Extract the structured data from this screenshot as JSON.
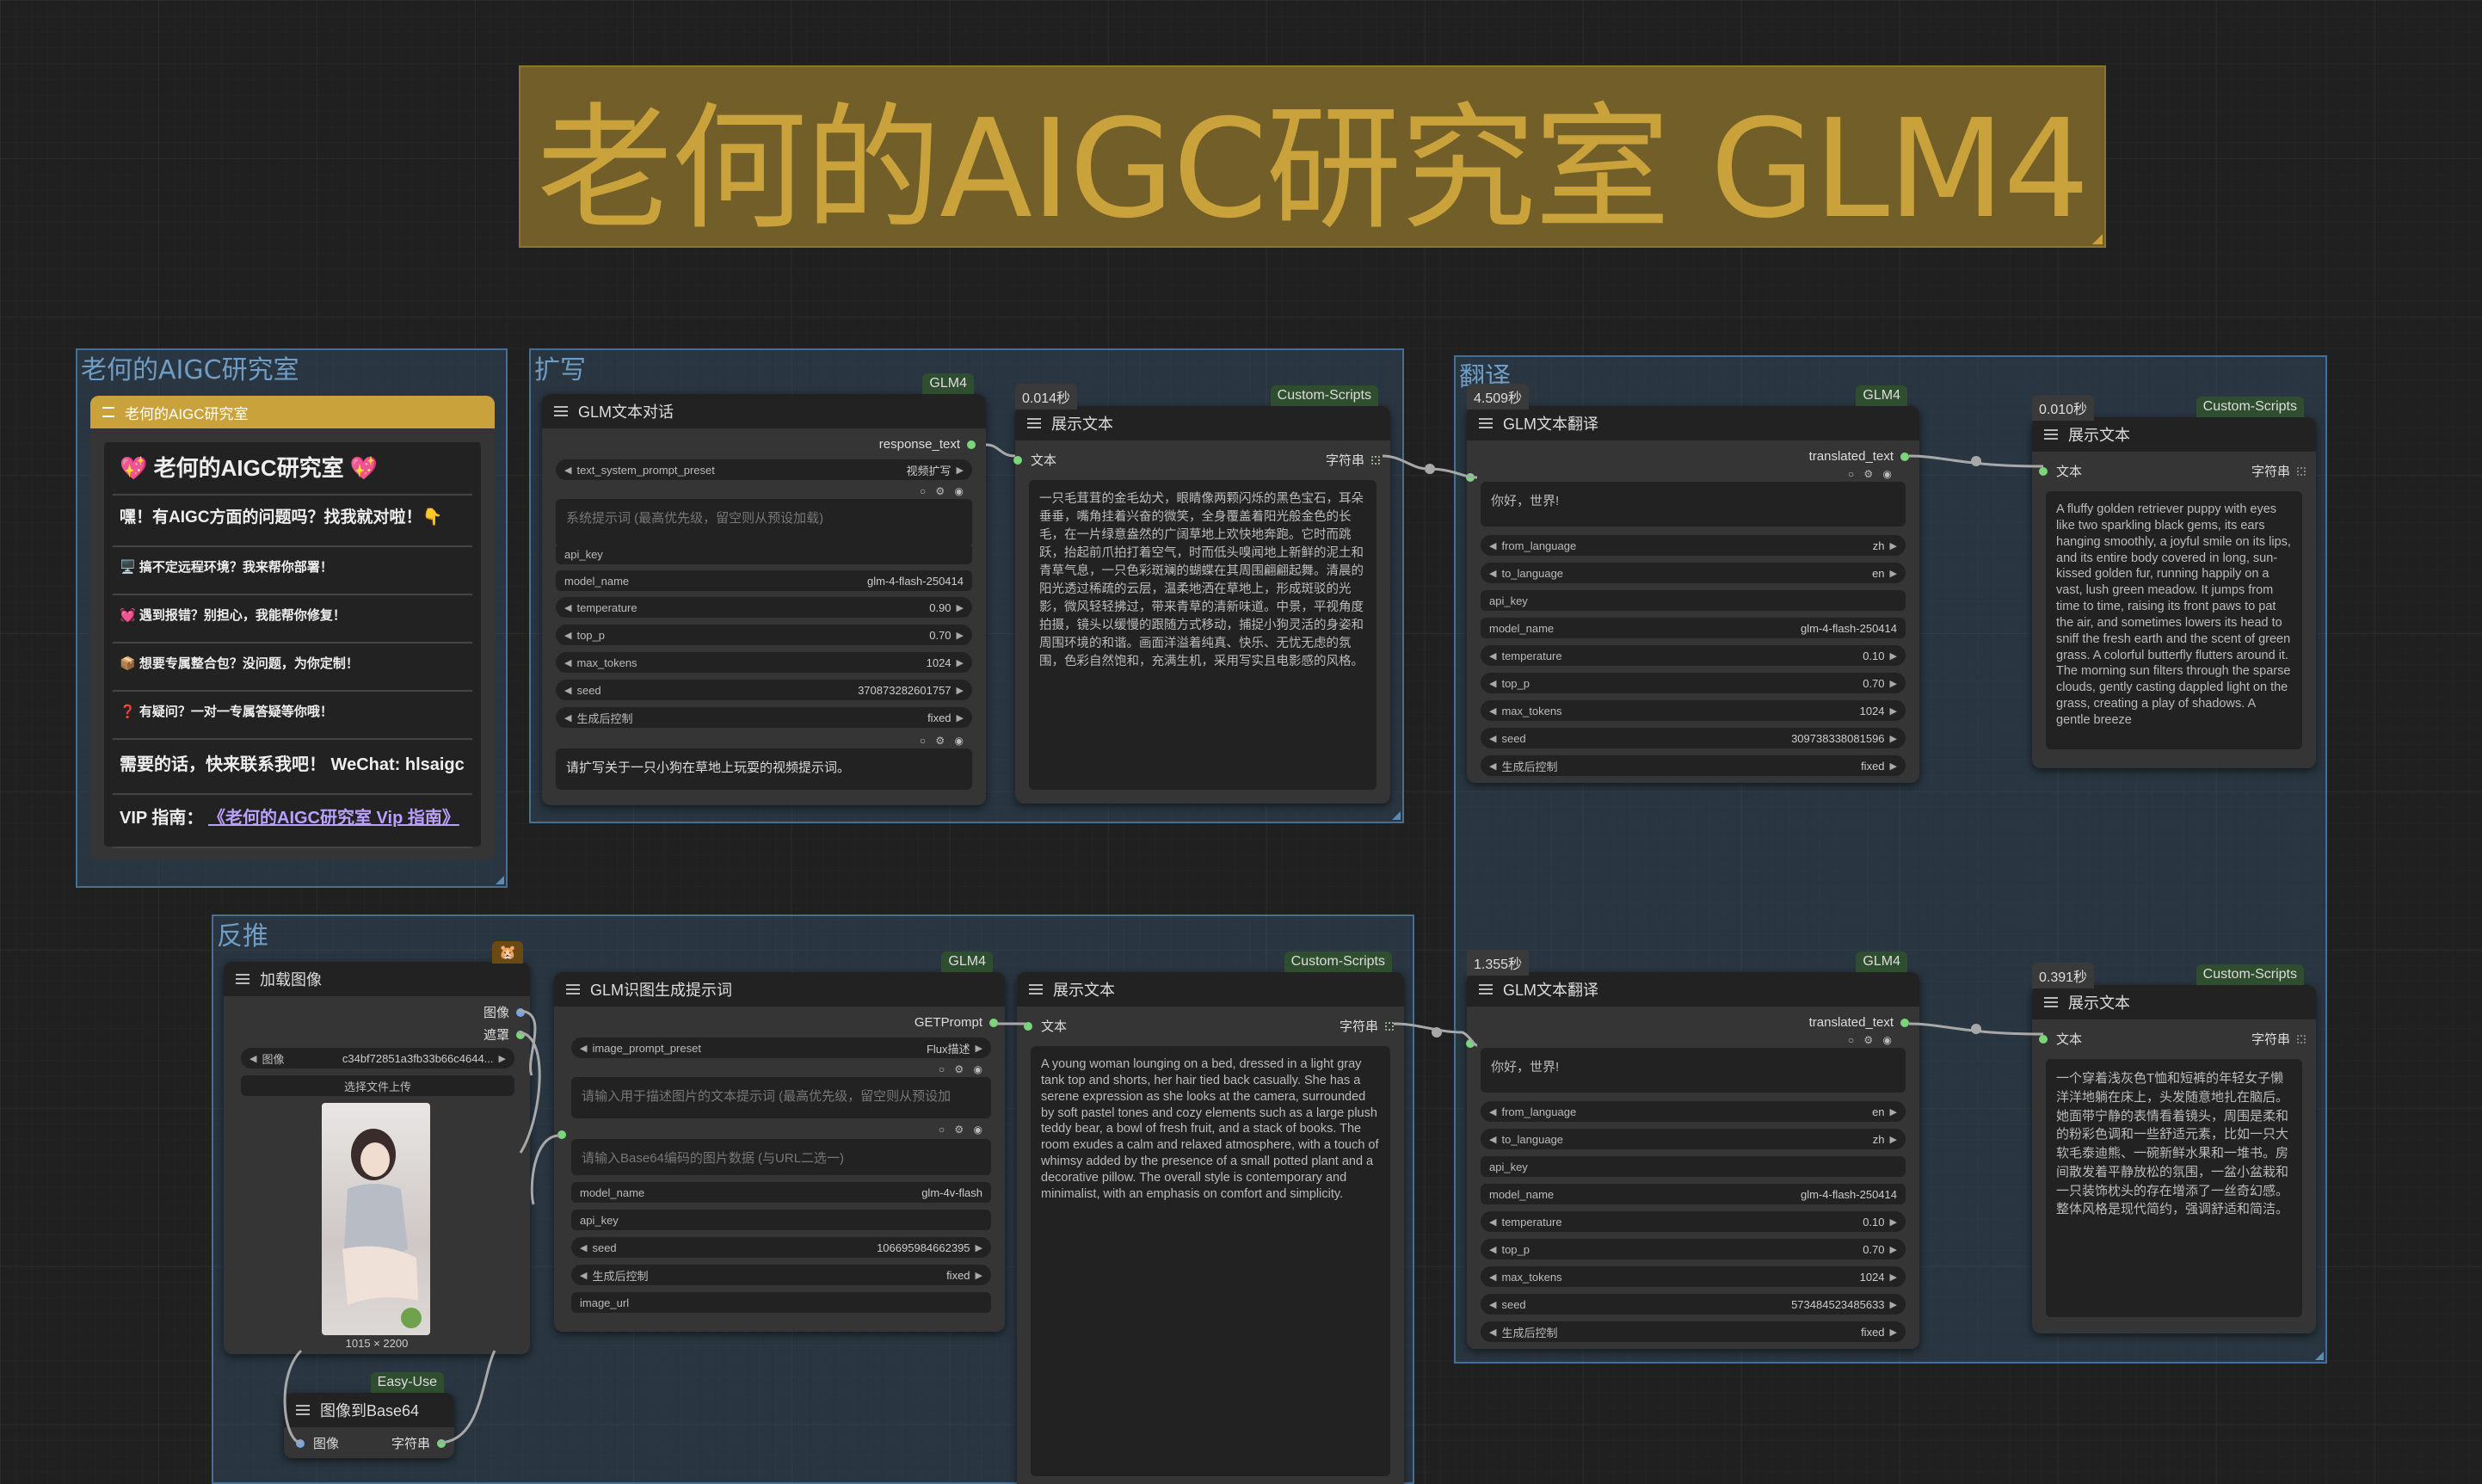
{
  "banner": {
    "title": "老何的AIGC研究室 GLM4"
  },
  "groups": {
    "lab": "老何的AIGC研究室",
    "expand": "扩写",
    "translate": "翻译",
    "reverse": "反推"
  },
  "promo": {
    "header": "老何的AIGC研究室",
    "title": "💖 老何的AIGC研究室 💖",
    "line1": "嘿！有AIGC方面的问题吗？找我就对啦！👇",
    "line2": "🖥️ 搞不定远程环境？我来帮你部署！",
    "line3": "💓 遇到报错？别担心，我能帮你修复！",
    "line4": "📦 想要专属整合包？没问题，为你定制！",
    "line5": "❓ 有疑问？一对一专属答疑等你哦！",
    "line6": "需要的话，快来联系我吧！ WeChat: hlsaigc",
    "vip_label": "VIP 指南：",
    "vip_link": "《老何的AIGC研究室 Vip 指南》"
  },
  "chat_node": {
    "badge": "GLM4",
    "title": "GLM文本对话",
    "output": "response_text",
    "preset_label": "text_system_prompt_preset",
    "preset_value": "视频扩写",
    "system_placeholder": "系统提示词 (最高优先级，留空则从预设加载)",
    "api_key": "api_key",
    "model_name_label": "model_name",
    "model_name": "glm-4-flash-250414",
    "temperature_label": "temperature",
    "temperature": "0.90",
    "top_p_label": "top_p",
    "top_p": "0.70",
    "max_tokens_label": "max_tokens",
    "max_tokens": "1024",
    "seed_label": "seed",
    "seed": "370873282601757",
    "control_label": "生成后控制",
    "control": "fixed",
    "user_prompt": "请扩写关于一只小狗在草地上玩耍的视频提示词。"
  },
  "show_text_1": {
    "time": "0.014秒",
    "badge": "Custom-Scripts",
    "title": "展示文本",
    "input": "文本",
    "output": "字符串",
    "text": "一只毛茸茸的金毛幼犬，眼睛像两颗闪烁的黑色宝石，耳朵垂垂，嘴角挂着兴奋的微笑，全身覆盖着阳光般金色的长毛，在一片绿意盎然的广阔草地上欢快地奔跑。它时而跳跃，抬起前爪拍打着空气，时而低头嗅闻地上新鲜的泥土和青草气息，一只色彩斑斓的蝴蝶在其周围翩翩起舞。清晨的阳光透过稀疏的云层，温柔地洒在草地上，形成斑驳的光影，微风轻轻拂过，带来青草的清新味道。中景，平视角度拍摄，镜头以缓慢的跟随方式移动，捕捉小狗灵活的身姿和周围环境的和谐。画面洋溢着纯真、快乐、无忧无虑的氛围，色彩自然饱和，充满生机，采用写实且电影感的风格。"
  },
  "translate_1": {
    "time": "4.509秒",
    "badge": "GLM4",
    "title": "GLM文本翻译",
    "output": "translated_text",
    "input_text": "你好，世界!",
    "from_label": "from_language",
    "from": "zh",
    "to_label": "to_language",
    "to": "en",
    "api_key": "api_key",
    "model_name_label": "model_name",
    "model_name": "glm-4-flash-250414",
    "temperature_label": "temperature",
    "temperature": "0.10",
    "top_p_label": "top_p",
    "top_p": "0.70",
    "max_tokens_label": "max_tokens",
    "max_tokens": "1024",
    "seed_label": "seed",
    "seed": "309738338081596",
    "control_label": "生成后控制",
    "control": "fixed"
  },
  "show_text_2": {
    "time": "0.010秒",
    "badge": "Custom-Scripts",
    "title": "展示文本",
    "input": "文本",
    "output": "字符串",
    "text": "A fluffy golden retriever puppy with eyes like two sparkling black gems, its ears hanging smoothly, a joyful smile on its lips, and its entire body covered in long, sun-kissed golden fur, running happily on a vast, lush green meadow. It jumps from time to time, raising its front paws to pat the air, and sometimes lowers its head to sniff the fresh earth and the scent of green grass. A colorful butterfly flutters around it. The morning sun filters through the sparse clouds, gently casting dappled light on the grass, creating a play of shadows. A gentle breeze"
  },
  "load_image": {
    "badge": "🐹",
    "title": "加载图像",
    "out_image": "图像",
    "out_mask": "遮罩",
    "image_label": "图像",
    "image_value": "c34bf72851a3fb33b66c4644...",
    "upload": "选择文件上传",
    "size": "1015 × 2200"
  },
  "to_base64": {
    "badge": "Easy-Use",
    "title": "图像到Base64",
    "input": "图像",
    "output": "字符串"
  },
  "vision_node": {
    "badge": "GLM4",
    "title": "GLM识图生成提示词",
    "output": "GETPrompt",
    "preset_label": "image_prompt_preset",
    "preset_value": "Flux描述",
    "prompt_placeholder": "请输入用于描述图片的文本提示词 (最高优先级，留空则从预设加",
    "base64_placeholder": "请输入Base64编码的图片数据 (与URL二选一)",
    "model_name_label": "model_name",
    "model_name": "glm-4v-flash",
    "api_key": "api_key",
    "seed_label": "seed",
    "seed": "106695984662395",
    "control_label": "生成后控制",
    "control": "fixed",
    "image_url": "image_url"
  },
  "show_text_3": {
    "badge": "Custom-Scripts",
    "title": "展示文本",
    "input": "文本",
    "output": "字符串",
    "text": "A young woman lounging on a bed, dressed in a light gray tank top and shorts, her hair tied back casually. She has a serene expression as she looks at the camera, surrounded by soft pastel tones and cozy elements such as a large plush teddy bear, a bowl of fresh fruit, and a stack of books. The room exudes a calm and relaxed atmosphere, with a touch of whimsy added by the presence of a small potted plant and a decorative pillow. The overall style is contemporary and minimalist, with an emphasis on comfort and simplicity."
  },
  "translate_2": {
    "time": "1.355秒",
    "badge": "GLM4",
    "title": "GLM文本翻译",
    "output": "translated_text",
    "input_text": "你好，世界!",
    "from_label": "from_language",
    "from": "en",
    "to_label": "to_language",
    "to": "zh",
    "api_key": "api_key",
    "model_name_label": "model_name",
    "model_name": "glm-4-flash-250414",
    "temperature_label": "temperature",
    "temperature": "0.10",
    "top_p_label": "top_p",
    "top_p": "0.70",
    "max_tokens_label": "max_tokens",
    "max_tokens": "1024",
    "seed_label": "seed",
    "seed": "573484523485633",
    "control_label": "生成后控制",
    "control": "fixed"
  },
  "show_text_4": {
    "time": "0.391秒",
    "badge": "Custom-Scripts",
    "title": "展示文本",
    "input": "文本",
    "output": "字符串",
    "text": "一个穿着浅灰色T恤和短裤的年轻女子懒洋洋地躺在床上，头发随意地扎在脑后。她面带宁静的表情看着镜头，周围是柔和的粉彩色调和一些舒适元素，比如一只大软毛泰迪熊、一碗新鲜水果和一堆书。房间散发着平静放松的氛围，一盆小盆栽和一只装饰枕头的存在增添了一丝奇幻感。整体风格是现代简约，强调舒适和简洁。"
  }
}
